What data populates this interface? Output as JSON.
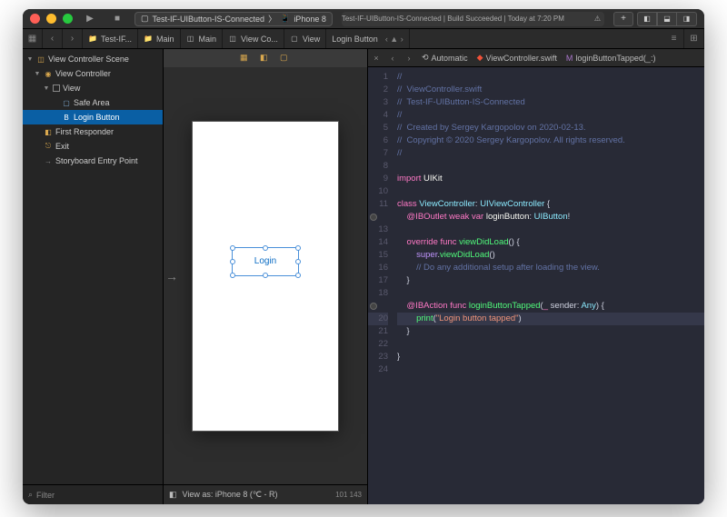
{
  "scheme": {
    "target": "Test-IF-UIButton-IS-Connected",
    "device": "iPhone 8"
  },
  "status": {
    "text": "Test-IF-UIButton-IS-Connected | Build Succeeded | Today at 7:20 PM",
    "warn_icon": "⚠︎"
  },
  "breadcrumb": {
    "items": [
      "Test-IF...",
      "Main",
      "Main",
      "View Co...",
      "View",
      "Login Button"
    ],
    "jump_icon": "▲"
  },
  "tree": {
    "scene": "View Controller Scene",
    "vc": "View Controller",
    "view": "View",
    "safe": "Safe Area",
    "login": "Login Button",
    "first": "First Responder",
    "exit": "Exit",
    "entry": "Storyboard Entry Point"
  },
  "sidebar_footer": {
    "filter_placeholder": "Filter"
  },
  "canvas": {
    "button_label": "Login",
    "footer": "View as: iPhone 8  (℃ - R)",
    "zoom": "101  143"
  },
  "editor_tabs": {
    "mode": "Automatic",
    "file": "ViewController.swift",
    "symbol": "loginButtonTapped(_:)"
  },
  "code": {
    "l1": "//",
    "l2": "//  ViewController.swift",
    "l3": "//  Test-IF-UIButton-IS-Connected",
    "l4": "//",
    "l5": "//  Created by Sergey Kargopolov on 2020-02-13.",
    "l6": "//  Copyright © 2020 Sergey Kargopolov. All rights reserved.",
    "l7": "//",
    "l9a": "import",
    "l9b": " UIKit",
    "l11a": "class",
    "l11b": " ViewController",
    "l11c": ": ",
    "l11d": "UIViewController",
    "l11e": " {",
    "l12a": "    @IBOutlet",
    "l12b": " weak var",
    "l12c": " loginButton",
    "l12d": ": ",
    "l12e": "UIButton",
    "l12f": "!",
    "l14a": "    override",
    "l14b": " func",
    "l14c": " viewDidLoad",
    "l14d": "() {",
    "l15a": "        super",
    "l15b": ".",
    "l15c": "viewDidLoad",
    "l15d": "()",
    "l16": "        // Do any additional setup after loading the view.",
    "l17": "    }",
    "l19a": "    @IBAction",
    "l19b": " func",
    "l19c": " loginButtonTapped",
    "l19d": "(",
    "l19e": "_",
    "l19f": " sender: ",
    "l19g": "Any",
    "l19h": ") {",
    "l20a": "        print",
    "l20b": "(",
    "l20c": "\"Login button tapped\"",
    "l20d": ")",
    "l21": "    }",
    "l23": "}"
  }
}
